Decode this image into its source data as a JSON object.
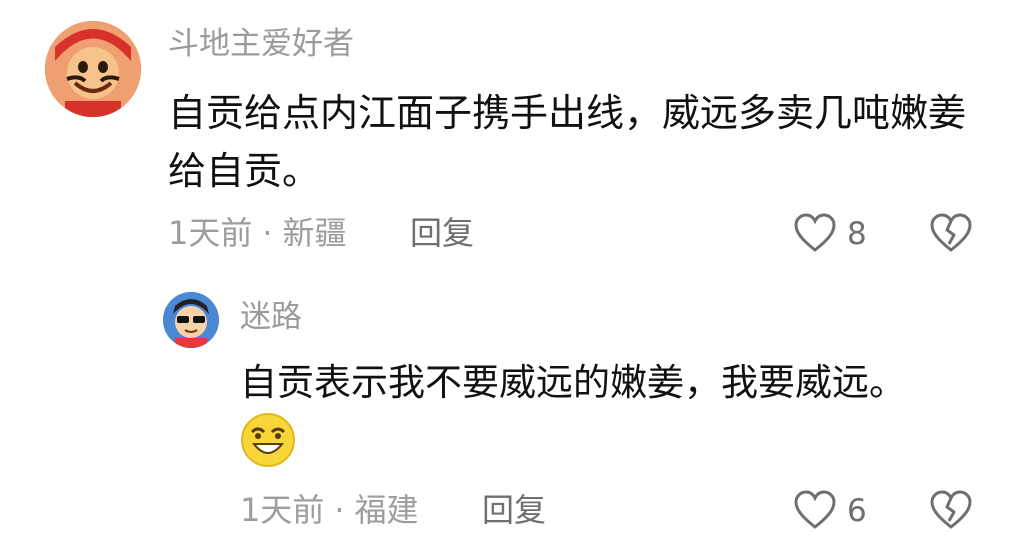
{
  "comments": [
    {
      "username": "斗地主爱好者",
      "content": "自贡给点内江面子携手出线，威远多卖几吨嫩姜给自贡。",
      "time": "1天前",
      "separator": "·",
      "location": "新疆",
      "reply_label": "回复",
      "likes": "8",
      "avatar_icon": "cartoon-landlord-avatar",
      "like_icon": "heart-outline-icon",
      "dislike_icon": "broken-heart-icon"
    },
    {
      "username": "迷路",
      "content": "自贡表示我不要威远的嫩姜，我要威远。",
      "emoji": "grinning-emoji",
      "time": "1天前",
      "separator": "·",
      "location": "福建",
      "reply_label": "回复",
      "likes": "6",
      "avatar_icon": "cartoon-boy-sunglasses-avatar",
      "like_icon": "heart-outline-icon",
      "dislike_icon": "broken-heart-icon"
    }
  ],
  "colors": {
    "text_primary": "#111111",
    "text_secondary": "#9b9b9b",
    "action_text": "#6f6f6f",
    "emoji_yellow": "#f7d63a"
  }
}
